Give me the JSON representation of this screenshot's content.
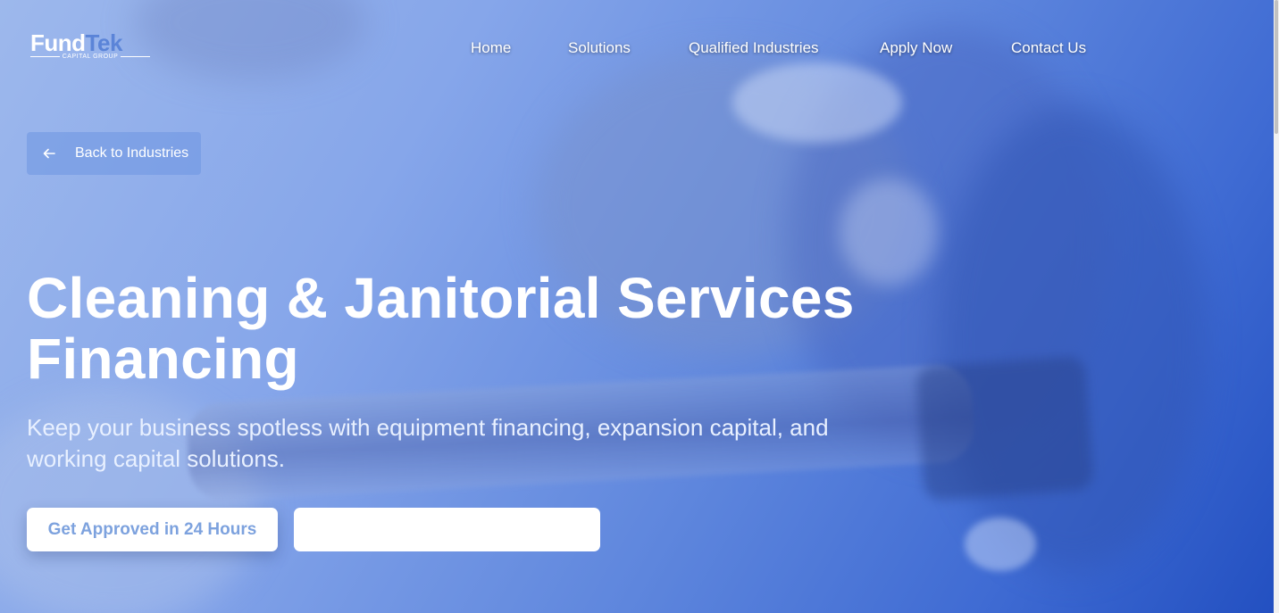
{
  "brand": {
    "name_part1": "Fund",
    "name_part2": "Tek",
    "tagline": "CAPITAL GROUP"
  },
  "nav": {
    "items": [
      {
        "label": "Home"
      },
      {
        "label": "Solutions"
      },
      {
        "label": "Qualified Industries"
      },
      {
        "label": "Apply Now"
      },
      {
        "label": "Contact Us"
      }
    ]
  },
  "back_link": {
    "label": "Back to Industries",
    "icon": "arrow-left-icon"
  },
  "hero": {
    "title": "Cleaning & Janitorial Services Financing",
    "subtitle": "Keep your business spotless with equipment financing, expansion capital, and working capital solutions."
  },
  "cta": {
    "primary_label": "Get Approved in 24 Hours",
    "secondary_label": ""
  },
  "colors": {
    "hero_gradient_start": "#9db8ec",
    "hero_gradient_end": "#2350c1",
    "primary_button_text": "#7da2de",
    "logo_accent": "#5b84d8"
  }
}
